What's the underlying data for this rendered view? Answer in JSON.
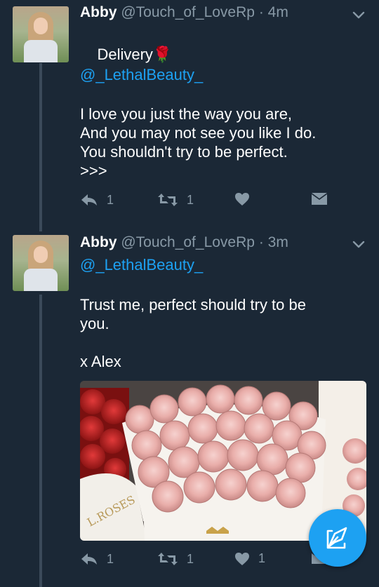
{
  "tweets": [
    {
      "name": "Abby",
      "handle": "@Touch_of_LoveRp",
      "separator": "·",
      "time": "4m",
      "line1": "Delivery",
      "emoji": "🌹",
      "mention": "@_LethalBeauty_",
      "text": "I love you just the way you are,\nAnd you may not see you like I do.\nYou shouldn't try to be perfect.\n>>>",
      "reply_count": "1",
      "retweet_count": "1",
      "like_count": ""
    },
    {
      "name": "Abby",
      "handle": "@Touch_of_LoveRp",
      "separator": "·",
      "time": "3m",
      "mention": "@_LethalBeauty_",
      "text": "Trust me, perfect should try to be\nyou.\n\nx Alex",
      "reply_count": "1",
      "retweet_count": "1",
      "like_count": "1"
    }
  ],
  "media": {
    "description_icon": "rose-box-photo",
    "box_label": "L.ROSES"
  },
  "colors": {
    "background": "#1b2836",
    "accent": "#1da1f2",
    "muted": "#8899a6"
  },
  "fab": {
    "icon": "compose-tweet-icon"
  }
}
